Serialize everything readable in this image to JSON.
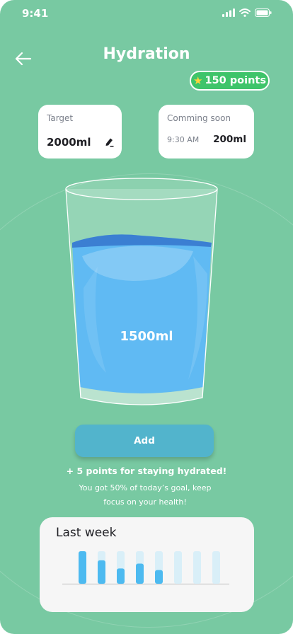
{
  "status_bar": {
    "time": "9:41"
  },
  "header": {
    "title": "Hydration",
    "points": "150 points"
  },
  "target_card": {
    "label": "Target",
    "value": "2000ml"
  },
  "soon_card": {
    "label": "Comming soon",
    "time": "9:30 AM",
    "amount": "200ml"
  },
  "glass": {
    "amount": "1500ml",
    "fill_fraction": 0.75
  },
  "add_button": {
    "label": "Add"
  },
  "message": {
    "headline": "+ 5 points for staying hydrated!",
    "detail": "You got 50% of today’s goal, keep focus on your health!"
  },
  "last_week": {
    "title": "Last week"
  },
  "chart_data": {
    "type": "bar",
    "title": "Last week",
    "categories": [
      "",
      "",
      "",
      "",
      "",
      "",
      "",
      ""
    ],
    "values": [
      1.0,
      0.72,
      0.47,
      0.62,
      0.42,
      0,
      0,
      0
    ],
    "ylim": [
      0,
      1
    ],
    "colors": {
      "fill": "#4dbaf0",
      "track": "#d9eff8"
    }
  },
  "colors": {
    "background": "#78c9a2",
    "points_badge": "#3ec46a",
    "add_button": "#52b4cc",
    "water": "#60baf3"
  }
}
